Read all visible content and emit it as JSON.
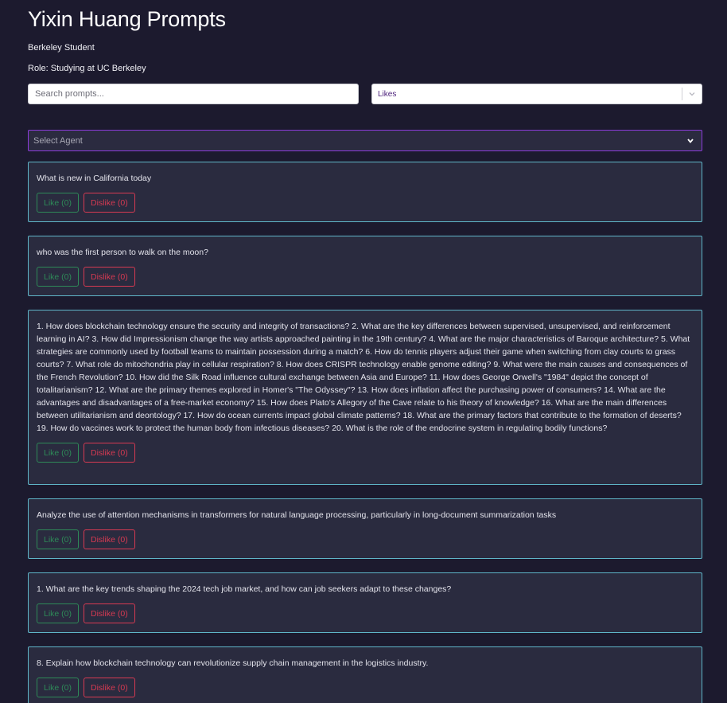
{
  "header": {
    "title": "Yixin Huang Prompts",
    "subtitle": "Berkeley Student",
    "role": "Role: Studying at UC Berkeley"
  },
  "search": {
    "placeholder": "Search prompts...",
    "value": ""
  },
  "sort": {
    "selected": "Likes",
    "icon": "chevron-down-icon"
  },
  "agent": {
    "placeholder": "Select Agent",
    "icon": "chevron-down-icon"
  },
  "colors": {
    "background": "#1c1a2e",
    "card_border": "#5fb5c8",
    "agent_border": "#8b3bd9",
    "like": "#2e8a58",
    "dislike": "#d73a52"
  },
  "prompts": [
    {
      "text": "What is new in California today",
      "like_label": "Like (0)",
      "dislike_label": "Dislike (0)"
    },
    {
      "text": "who was the first person to walk on the moon?",
      "like_label": "Like (0)",
      "dislike_label": "Dislike (0)"
    },
    {
      "text": "1. How does blockchain technology ensure the security and integrity of transactions? 2. What are the key differences between supervised, unsupervised, and reinforcement learning in AI? 3. How did Impressionism change the way artists approached painting in the 19th century? 4. What are the major characteristics of Baroque architecture? 5. What strategies are commonly used by football teams to maintain possession during a match? 6. How do tennis players adjust their game when switching from clay courts to grass courts? 7. What role do mitochondria play in cellular respiration? 8. How does CRISPR technology enable genome editing? 9. What were the main causes and consequences of the French Revolution? 10. How did the Silk Road influence cultural exchange between Asia and Europe? 11. How does George Orwell's \"1984\" depict the concept of totalitarianism? 12. What are the primary themes explored in Homer's \"The Odyssey\"? 13. How does inflation affect the purchasing power of consumers? 14. What are the advantages and disadvantages of a free-market economy? 15. How does Plato's Allegory of the Cave relate to his theory of knowledge? 16. What are the main differences between utilitarianism and deontology? 17. How do ocean currents impact global climate patterns? 18. What are the primary factors that contribute to the formation of deserts? 19. How do vaccines work to protect the human body from infectious diseases? 20. What is the role of the endocrine system in regulating bodily functions?",
      "like_label": "Like (0)",
      "dislike_label": "Dislike (0)"
    },
    {
      "text": "Analyze the use of attention mechanisms in transformers for natural language processing, particularly in long-document summarization tasks",
      "like_label": "Like (0)",
      "dislike_label": "Dislike (0)"
    },
    {
      "text": "1. What are the key trends shaping the 2024 tech job market, and how can job seekers adapt to these changes?",
      "like_label": "Like (0)",
      "dislike_label": "Dislike (0)"
    },
    {
      "text": "8. Explain how blockchain technology can revolutionize supply chain management in the logistics industry.",
      "like_label": "Like (0)",
      "dislike_label": "Dislike (0)"
    }
  ]
}
